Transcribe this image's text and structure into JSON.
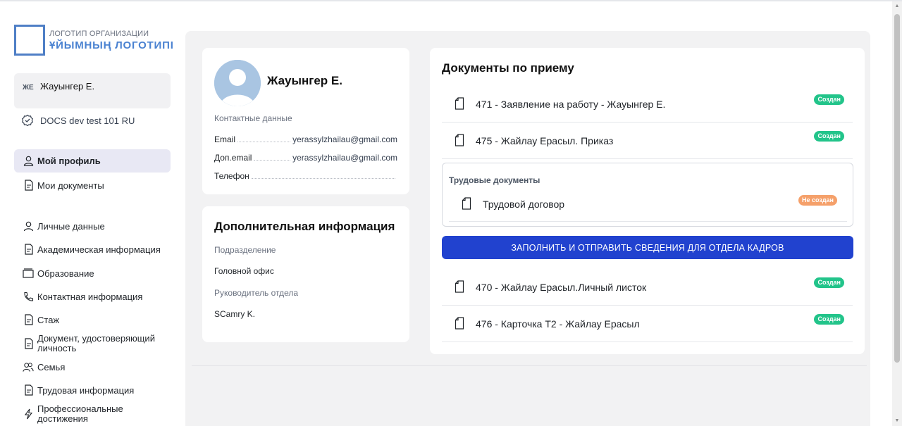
{
  "logo": {
    "line1": "ЛОГОТИП ОРГАНИЗАЦИИ",
    "line2": "ҰЙЫМНЫҢ ЛОГОТИПІ",
    "brand_color": "#4f7fc6"
  },
  "sidebar": {
    "user": {
      "initials": "ЖЕ",
      "name": "Жауынгер Е."
    },
    "org": {
      "label": "DOCS dev test 101 RU",
      "icon": "gear-badge-icon"
    },
    "items": [
      {
        "label": "Мой профиль",
        "icon": "user-icon",
        "active": true
      },
      {
        "label": "Мои документы",
        "icon": "document-icon"
      },
      {
        "label": "Личные данные",
        "icon": "user-icon"
      },
      {
        "label": "Академическая информация",
        "icon": "document-icon"
      },
      {
        "label": "Образование",
        "icon": "folder-icon"
      },
      {
        "label": "Контактная информация",
        "icon": "phone-icon"
      },
      {
        "label": "Стаж",
        "icon": "document-icon"
      },
      {
        "label": "Документ, удостоверяющий личность",
        "icon": "document-icon"
      },
      {
        "label": "Семья",
        "icon": "users-icon"
      },
      {
        "label": "Трудовая информация",
        "icon": "document-icon"
      },
      {
        "label": "Профессиональные достижения",
        "icon": "lightning-icon"
      }
    ]
  },
  "profile": {
    "name": "Жауынгер Е.",
    "contact_title": "Контактные данные",
    "contacts": [
      {
        "label": "Email",
        "value": "yerassylzhailau@gmail.com"
      },
      {
        "label": "Доп.email",
        "value": "yerassylzhailau@gmail.com"
      },
      {
        "label": "Телефон",
        "value": ""
      }
    ]
  },
  "extra": {
    "title": "Дополнительная информация",
    "department_label": "Подразделение",
    "department_value": "Головной офис",
    "head_label": "Руководитель отдела",
    "head_value": "SCamry K."
  },
  "documents": {
    "title": "Документы по приему",
    "top_items": [
      {
        "text": "471 - Заявление на работу - Жауынгер Е.",
        "status": "Создан"
      },
      {
        "text": "475 - Жайлау Ерасыл. Приказ",
        "status": "Создан"
      }
    ],
    "labor_group": {
      "title": "Трудовые документы",
      "item": {
        "text": "Трудовой договор",
        "status": "Не создан"
      }
    },
    "submit_label": "ЗАПОЛНИТЬ И ОТПРАВИТЬ СВЕДЕНИЯ ДЛЯ ОТДЕЛА КАДРОВ",
    "bottom_items": [
      {
        "text": "470 - Жайлау Ерасыл.Личный листок",
        "status": "Создан"
      },
      {
        "text": "476 - Карточка Т2 - Жайлау Ерасыл",
        "status": "Создан"
      }
    ]
  },
  "colors": {
    "accent": "#2142cf",
    "status_created": "#22c48a",
    "status_not_created": "#f5a06a",
    "active_nav_bg": "#e8e8f4"
  }
}
